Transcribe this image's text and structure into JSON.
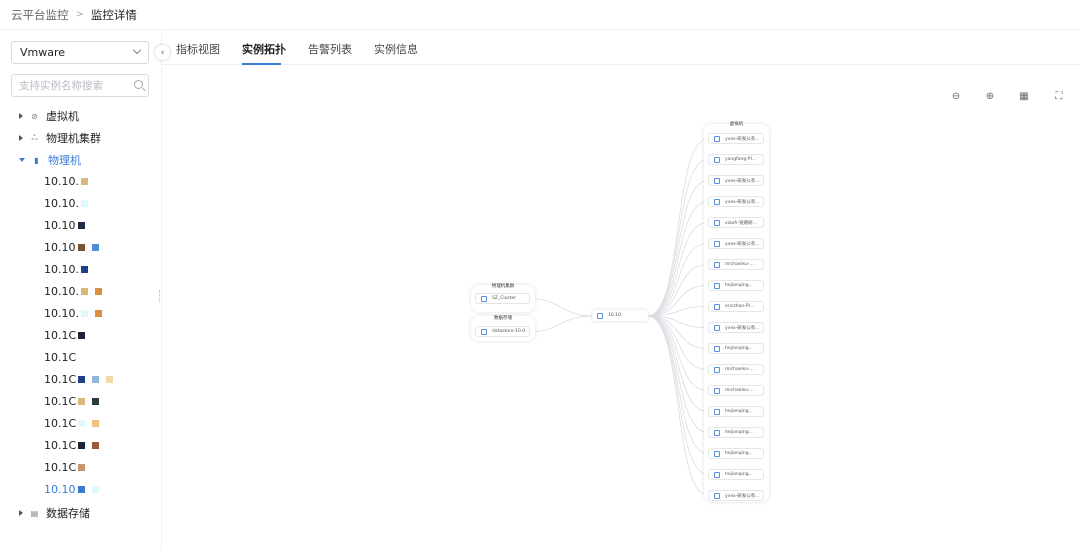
{
  "breadcrumb": {
    "root": "云平台监控",
    "separator": ">",
    "current": "监控详情"
  },
  "sidebar": {
    "select_value": "Vmware",
    "search_placeholder": "支持实例名称搜索",
    "tree": [
      {
        "label": "虚拟机",
        "icon": "link-icon",
        "expanded": false
      },
      {
        "label": "物理机集群",
        "icon": "cluster-icon",
        "expanded": false
      },
      {
        "label": "物理机",
        "icon": "server-icon",
        "expanded": true
      },
      {
        "label": "数据存储",
        "icon": "storage-icon",
        "expanded": false
      }
    ],
    "hosts": [
      {
        "label": "10.10.",
        "swatches": [
          "#d9b97a"
        ]
      },
      {
        "label": "10.10.",
        "swatches": [
          "#dff8fb"
        ]
      },
      {
        "label": "10.10",
        "swatches": [
          "#1f2a44"
        ]
      },
      {
        "label": "10.10",
        "swatches": [
          "#7a5234",
          "#4a8fd6"
        ]
      },
      {
        "label": "10.10.",
        "swatches": [
          "#1e3f8a"
        ]
      },
      {
        "label": "10.10.",
        "swatches": [
          "#d9b97a",
          "#d98f3d"
        ]
      },
      {
        "label": "10.10.",
        "swatches": [
          "#dff8fb",
          "#d98f3d"
        ]
      },
      {
        "label": "10.1C",
        "swatches": [
          "#1c2333"
        ]
      },
      {
        "label": "10.1C",
        "swatches": []
      },
      {
        "label": "10.1C",
        "swatches": [
          "#1e3f8a",
          "#8fb6de",
          "#f0d9a6"
        ]
      },
      {
        "label": "10.1C",
        "swatches": [
          "#d9b97a",
          "#2b3a3f"
        ]
      },
      {
        "label": "10.1C",
        "swatches": [
          "#dff8fb",
          "#f2c27a"
        ]
      },
      {
        "label": "10.1C",
        "swatches": [
          "#1c2333",
          "#9a5a35"
        ]
      },
      {
        "label": "10.1C",
        "swatches": [
          "#c9956a"
        ]
      },
      {
        "label": "10.10",
        "swatches": [
          "#3a7bd5",
          "#dff8fb"
        ],
        "selected": true
      }
    ]
  },
  "tabs": [
    {
      "label": "指标视图",
      "active": false
    },
    {
      "label": "实例拓扑",
      "active": true
    },
    {
      "label": "告警列表",
      "active": false
    },
    {
      "label": "实例信息",
      "active": false
    }
  ],
  "toolbar": [
    "zoom-out-icon",
    "zoom-in-icon",
    "fit-view-icon",
    "fullscreen-icon"
  ],
  "topology": {
    "left_groups": [
      {
        "title": "物理机集群",
        "node": "SZ_Cluster",
        "icon": "cluster-icon"
      },
      {
        "title": "数据存储",
        "node": "datastore-10.0",
        "icon": "storage-icon"
      }
    ],
    "center_node": "10.10.",
    "vm_group_title": "虚拟机",
    "vms": [
      "yvex-研发公有...",
      "yangfang-PI...",
      "yvex-研发公有...",
      "yvex-研发公有...",
      "xiaofr-链路研...",
      "yvex-研发公有...",
      "michaelsu-...",
      "hejianqing...",
      "ericzhan-PI...",
      "yvex-研发公有...",
      "hejianqing...",
      "michaelsu-...",
      "michaelsu-...",
      "hejianqing...",
      "hejianqing...",
      "hejianqing...",
      "hejianqing...",
      "yvex-研发公有..."
    ]
  },
  "colors": {
    "accent": "#3a7bd5",
    "border": "#eef0f3"
  }
}
